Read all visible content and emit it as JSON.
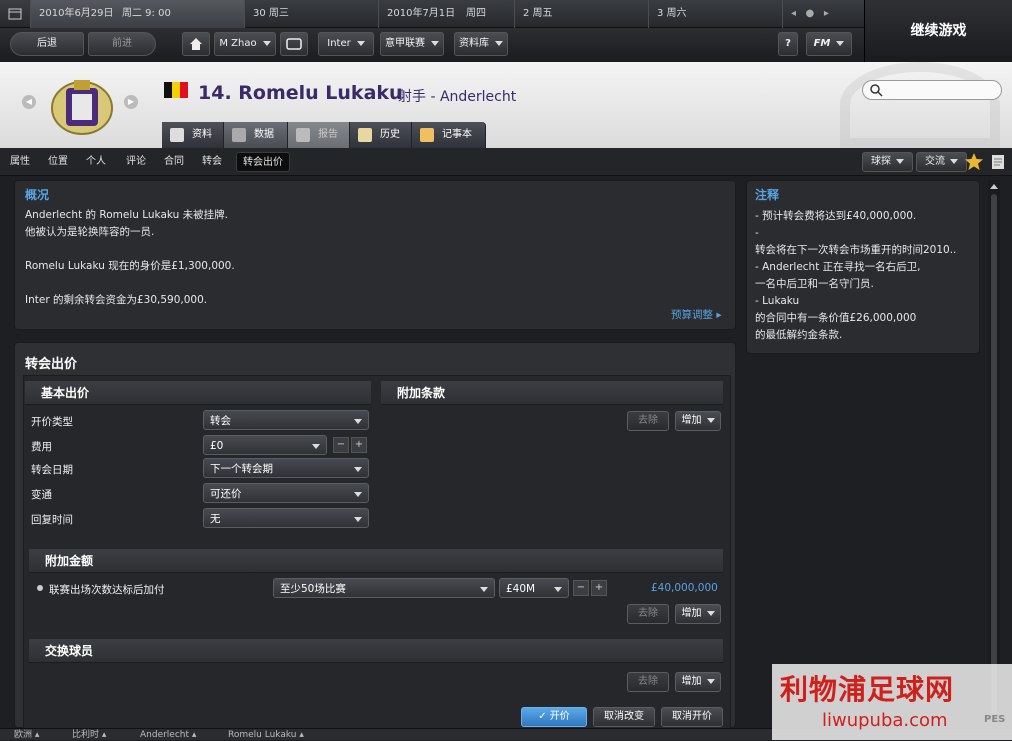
{
  "datebar": {
    "cells": [
      "2010年6月29日",
      "周二 9: 00",
      "30 周三",
      "2010年7月1日",
      "周四",
      "2 周五",
      "3 周六"
    ]
  },
  "toolbar": {
    "back": "后退",
    "forward": "前进",
    "manager": "M Zhao",
    "club": "Inter",
    "league": "意甲联赛",
    "database": "资料库",
    "help": "?",
    "fm": "FM",
    "continue": "继续游戏"
  },
  "header": {
    "player_name": "14. Romelu Lukaku",
    "position": "射手",
    "club": "- Anderlecht",
    "tabs": [
      "资料",
      "数据",
      "报告",
      "历史",
      "记事本"
    ]
  },
  "subnav": {
    "items": [
      "属性",
      "位置",
      "个人",
      "评论",
      "合同",
      "转会",
      "转会出价"
    ],
    "scout": "球探",
    "interact": "交流"
  },
  "overview": {
    "title": "概况",
    "lines": [
      "Anderlecht 的 Romelu Lukaku 未被挂牌.",
      "他被认为是轮换阵容的一员.",
      "",
      "Romelu Lukaku 现在的身价是£1,300,000.",
      "",
      "Inter 的剩余转会资金为£30,590,000."
    ],
    "budget_link": "预算调整"
  },
  "notes": {
    "title": "注释",
    "lines": [
      "- 预计转会费将达到£40,000,000.",
      "-",
      "转会将在下一次转会市场重开的时间2010..",
      "- Anderlecht 正在寻找一名右后卫,",
      "一名中后卫和一名守门员.",
      "- Lukaku",
      "的合同中有一条价值£26,000,000",
      "的最低解约金条款."
    ]
  },
  "offer": {
    "title": "转会出价",
    "basic": {
      "title": "基本出价",
      "rows": [
        {
          "label": "开价类型",
          "value": "转会"
        },
        {
          "label": "费用",
          "value": "£0"
        },
        {
          "label": "转会日期",
          "value": "下一个转会期"
        },
        {
          "label": "变通",
          "value": "可还价"
        },
        {
          "label": "回复时间",
          "value": "无"
        }
      ]
    },
    "clauses": {
      "title": "附加条款",
      "remove": "去除",
      "add": "增加"
    },
    "extra": {
      "title": "附加金额",
      "item_label": "联赛出场次数达标后加付",
      "condition": "至少50场比赛",
      "amount": "£40M",
      "total": "£40,000,000",
      "remove": "去除",
      "add": "增加"
    },
    "exchange": {
      "title": "交换球员",
      "remove": "去除",
      "add": "增加"
    },
    "actions": {
      "submit": "开价",
      "cancel_changes": "取消改变",
      "cancel_offer": "取消开价"
    }
  },
  "statusbar": {
    "crumbs": [
      "欧洲",
      "比利时",
      "Anderlecht",
      "Romelu Lukaku"
    ]
  },
  "ad": {
    "title": "利物浦足球网",
    "url": "liwupuba.com",
    "tag": "PES"
  },
  "colors": {
    "accent_blue": "#5aa2e0",
    "name_purple": "#3a2a6a",
    "panel_bg": "#2a2c30",
    "ad_red": "#d0201c"
  }
}
